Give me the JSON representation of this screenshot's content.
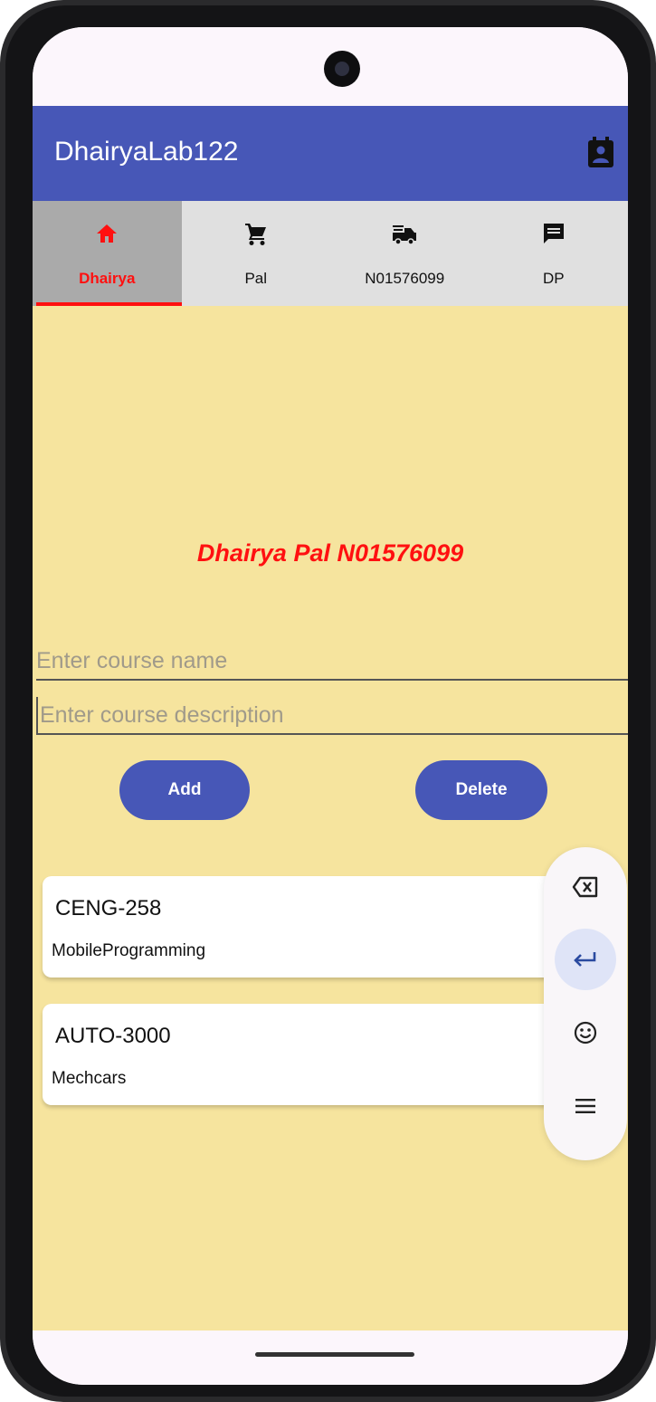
{
  "app": {
    "title": "DhairyaLab122",
    "action_icon": "contact-page-icon",
    "colors": {
      "appbar": "#4757b7",
      "tabs_bg": "#e0e0e0",
      "active_tab_bg": "#aaaaaa",
      "accent_red": "#ff1010",
      "content_bg": "#f6e49e"
    }
  },
  "tabs": [
    {
      "label": "Dhairya",
      "icon": "home-icon",
      "active": true
    },
    {
      "label": "Pal",
      "icon": "cart-icon",
      "active": false
    },
    {
      "label": "N01576099",
      "icon": "fire-truck-icon",
      "active": false
    },
    {
      "label": "DP",
      "icon": "message-icon",
      "active": false
    }
  ],
  "main": {
    "heading": "Dhairya Pal N01576099",
    "course_name": {
      "value": "",
      "placeholder": "Enter course name"
    },
    "course_description": {
      "value": "",
      "placeholder": "Enter course description"
    },
    "add_label": "Add",
    "delete_label": "Delete"
  },
  "courses": [
    {
      "code": "CENG-258",
      "description": "MobileProgramming"
    },
    {
      "code": "AUTO-3000",
      "description": "Mechcars"
    }
  ],
  "keyboard_tools": [
    "backspace-icon",
    "enter-icon",
    "emoji-icon",
    "menu-icon"
  ]
}
